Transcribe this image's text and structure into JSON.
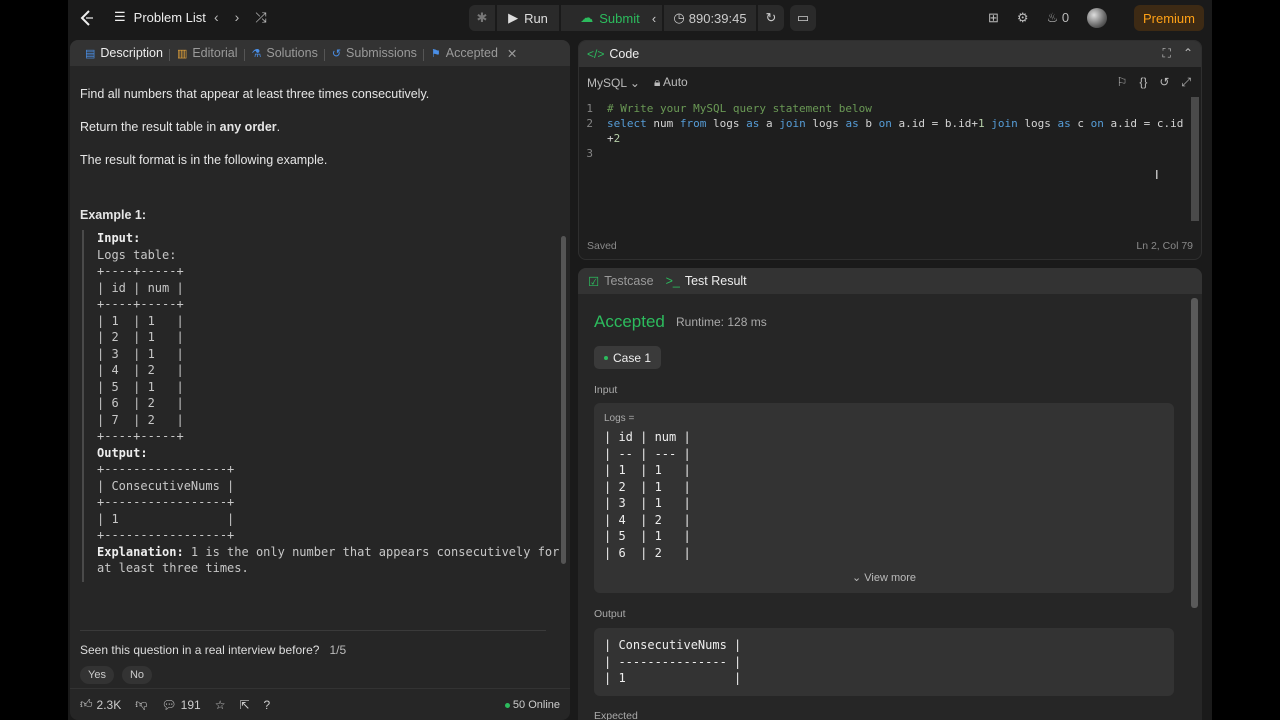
{
  "topbar": {
    "problem_list": "Problem List",
    "run": "Run",
    "submit": "Submit",
    "timer": "890:39:45",
    "streak": "0",
    "premium": "Premium"
  },
  "left_tabs": [
    {
      "label": "Description"
    },
    {
      "label": "Editorial"
    },
    {
      "label": "Solutions"
    },
    {
      "label": "Submissions"
    },
    {
      "label": "Accepted"
    }
  ],
  "description": {
    "p1": "Find all numbers that appear at least three times consecutively.",
    "p2_pre": "Return the result table in ",
    "p2_bold": "any order",
    "p2_post": ".",
    "p3": "The result format is in the following example.",
    "example_title": "Example 1:",
    "input_label": "Input:",
    "example_input": "Logs table:\n+----+-----+\n| id | num |\n+----+-----+\n| 1  | 1   |\n| 2  | 1   |\n| 3  | 1   |\n| 4  | 2   |\n| 5  | 1   |\n| 6  | 2   |\n| 7  | 2   |\n+----+-----+",
    "output_label": "Output:",
    "example_output": "+-----------------+\n| ConsecutiveNums |\n+-----------------+\n| 1               |\n+-----------------+",
    "explanation_label": "Explanation:",
    "explanation_text": " 1 is the only number that appears consecutively for\nat least three times."
  },
  "feedback": {
    "question": "Seen this question in a real interview before?",
    "fraction": "1/5",
    "yes": "Yes",
    "no": "No"
  },
  "left_footer": {
    "likes": "2.3K",
    "comments": "191",
    "online": "50 Online"
  },
  "code_panel": {
    "title": "Code",
    "language": "MySQL",
    "auto": "Auto",
    "saved": "Saved",
    "position": "Ln 2, Col 79",
    "lines": [
      {
        "no": "1",
        "text": "# Write your MySQL query statement below"
      },
      {
        "no": "2",
        "text": "select num from logs as a join logs as b on a.id = b.id+1 join logs as c on a.id = c.id"
      },
      {
        "no": "",
        "text": "+2"
      },
      {
        "no": "3",
        "text": ""
      }
    ]
  },
  "result_panel": {
    "tab_testcase": "Testcase",
    "tab_result": "Test Result",
    "status": "Accepted",
    "runtime": "Runtime: 128 ms",
    "case": "Case 1",
    "input_label": "Input",
    "input_var": "Logs =",
    "input_table": "| id | num |\n| -- | --- |\n| 1  | 1   |\n| 2  | 1   |\n| 3  | 1   |\n| 4  | 2   |\n| 5  | 1   |\n| 6  | 2   |",
    "view_more": "View more",
    "output_label": "Output",
    "output_table": "| ConsecutiveNums |\n| --------------- |\n| 1               |",
    "expected_label": "Expected"
  },
  "colors": {
    "accent_green": "#2cbb5d",
    "premium": "#ffa116"
  }
}
